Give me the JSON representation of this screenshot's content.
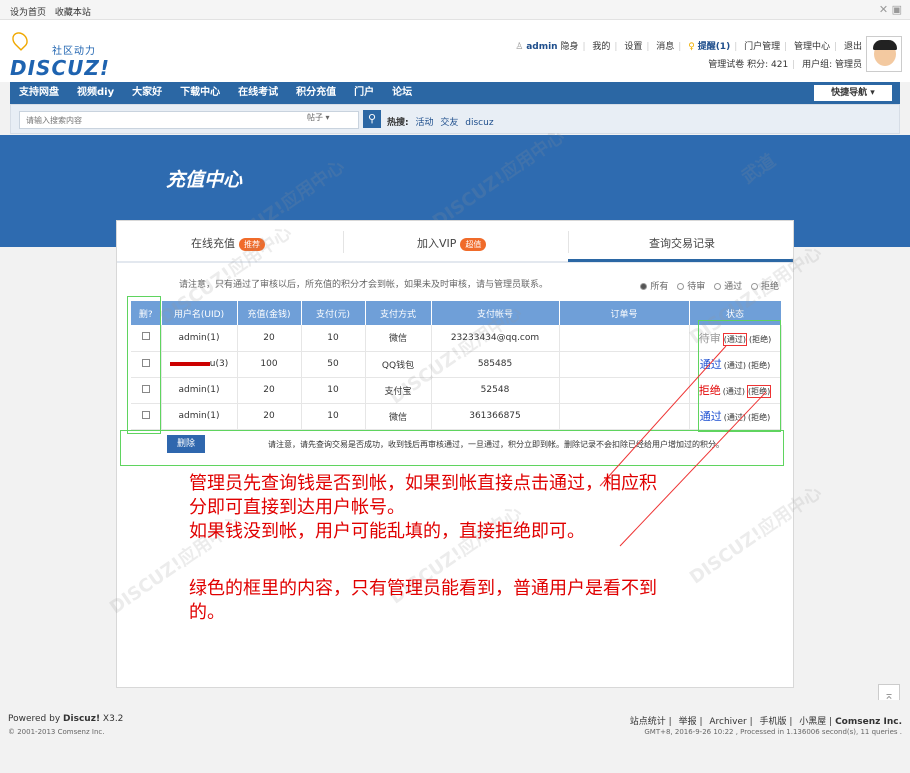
{
  "topbar": {
    "links": [
      "设为首页",
      "收藏本站"
    ]
  },
  "header": {
    "slogan": "社区动力",
    "logo": "DISCUZ!",
    "user": {
      "name": "admin",
      "items": [
        "隐身",
        "我的",
        "设置",
        "消息"
      ],
      "remind": "提醒(1)",
      "admin_links": [
        "门户管理",
        "管理中心",
        "退出"
      ],
      "row2": [
        "管理试卷",
        "积分: 421",
        "用户组: 管理员"
      ]
    }
  },
  "nav": {
    "items": [
      "支持网盘",
      "视频diy",
      "大家好",
      "下载中心",
      "在线考试",
      "积分充值",
      "门户",
      "论坛"
    ],
    "quick": "快捷导航 ▾"
  },
  "search": {
    "placeholder": "请输入搜索内容",
    "type": "帖子 ▾",
    "hot_label": "热搜:",
    "hot": [
      "活动",
      "交友",
      "discuz"
    ]
  },
  "banner": {
    "title": "充值中心"
  },
  "tabs": [
    {
      "label": "在线充值",
      "badge": "推荐"
    },
    {
      "label": "加入VIP",
      "badge": "超值"
    },
    {
      "label": "查询交易记录",
      "badge": ""
    }
  ],
  "notice": "请注意，只有通过了审核以后，所充值的积分才会到帐，如果未及时审核，请与管理员联系。",
  "filter": [
    "所有",
    "待审",
    "通过",
    "拒绝"
  ],
  "table": {
    "headers": [
      "删?",
      "用户名(UID)",
      "充值(金钱)",
      "支付(元)",
      "支付方式",
      "支付帐号",
      "订单号",
      "状态"
    ],
    "rows": [
      {
        "user": "admin(1)",
        "amount": "20",
        "pay": "10",
        "method": "微信",
        "account": "23233434@qq.com",
        "order": "",
        "status": "待审",
        "approve": "(通过)",
        "reject": "(拒绝)"
      },
      {
        "user": "u(3)",
        "amount": "100",
        "pay": "50",
        "method": "QQ钱包",
        "account": "585485",
        "order": "",
        "status": "通过",
        "approve": "(通过)",
        "reject": "(拒绝)"
      },
      {
        "user": "admin(1)",
        "amount": "20",
        "pay": "10",
        "method": "支付宝",
        "account": "52548",
        "order": "",
        "status": "拒绝",
        "approve": "(通过)",
        "reject": "(拒绝)"
      },
      {
        "user": "admin(1)",
        "amount": "20",
        "pay": "10",
        "method": "微信",
        "account": "361366875",
        "order": "",
        "status": "通过",
        "approve": "(通过)",
        "reject": "(拒绝)"
      }
    ]
  },
  "delete_button": "删除",
  "delete_note": "请注意，请先查询交易是否成功，收到钱后再审核通过，一旦通过，积分立即到帐。删除记录不会扣除已经给用户增加过的积分。",
  "annotations": {
    "line1": "管理员先查询钱是否到帐，如果到帐直接点击通过，相应积",
    "line2": "分即可直接到达用户帐号。",
    "line3": "如果钱没到帐，用户可能乱填的，直接拒绝即可。",
    "line4": "绿色的框里的内容，只有管理员能看到，普通用户是看不到",
    "line5": "的。"
  },
  "footer": {
    "powered": "Powered by",
    "brand": "Discuz!",
    "version": "X3.2",
    "copyright": "© 2001-2013 Comsenz Inc.",
    "links": [
      "站点统计",
      "举报",
      "Archiver",
      "手机版",
      "小黑屋"
    ],
    "company": "Comsenz Inc.",
    "gmt": "GMT+8, 2016-9-26 10:22 , Processed in 1.136006 second(s), 11 queries ."
  },
  "colors": {
    "brand": "#2b67a4",
    "banner": "#2e6bb0",
    "annotation": "#e00000",
    "green_box": "#5fd45f"
  }
}
